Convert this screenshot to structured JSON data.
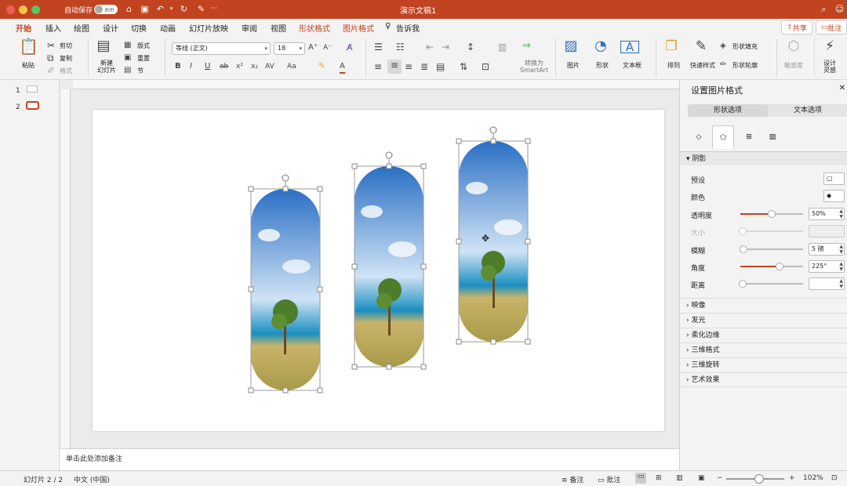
{
  "window": {
    "title": "演示文稿1",
    "autosave_label": "自动保存",
    "autosave_state": "关闭"
  },
  "tabs": [
    {
      "label": "开始",
      "active": true
    },
    {
      "label": "插入"
    },
    {
      "label": "绘图"
    },
    {
      "label": "设计"
    },
    {
      "label": "切换"
    },
    {
      "label": "动画"
    },
    {
      "label": "幻灯片放映"
    },
    {
      "label": "审阅"
    },
    {
      "label": "视图"
    },
    {
      "label": "形状格式",
      "contextual": true
    },
    {
      "label": "图片格式",
      "contextual": true
    },
    {
      "label": "告诉我"
    }
  ],
  "header_buttons": {
    "share": "共享",
    "comment": "批注"
  },
  "ribbon": {
    "paste": "粘贴",
    "cut": "剪切",
    "copy": "复制",
    "format": "格式",
    "new_slide": "新建\n幻灯片",
    "layout": "版式",
    "reset": "重置",
    "section": "节",
    "font_name": "等线 (正文)",
    "font_size": "18",
    "convert_smartart": "转换为\nSmartArt",
    "picture": "图片",
    "shape": "形状",
    "textbox": "文本框",
    "arrange": "排列",
    "quick_styles": "快速样式",
    "shape_fill": "形状填充",
    "shape_outline": "形状轮廓",
    "sensitivity": "敏感度",
    "designer": "设计\n灵感"
  },
  "slides_panel": {
    "items": [
      {
        "number": "1"
      },
      {
        "number": "2",
        "selected": true
      }
    ]
  },
  "notes_placeholder": "单击此处添加备注",
  "status": {
    "slide_counter": "幻灯片 2 / 2",
    "language": "中文 (中国)",
    "notes": "备注",
    "comments": "批注",
    "zoom": "102%",
    "zoom_fraction": 0.55
  },
  "format_pane": {
    "title": "设置图片格式",
    "tab_shape": "形状选项",
    "tab_text": "文本选项",
    "section_shadow": "阴影",
    "rows": {
      "preset": "预设",
      "color": "颜色",
      "transparency": {
        "label": "透明度",
        "value": "50%",
        "fraction": 0.5
      },
      "size": {
        "label": "大小",
        "value": ""
      },
      "blur": {
        "label": "模糊",
        "value": "5 磅",
        "fraction": 0.05
      },
      "angle": {
        "label": "角度",
        "value": "225°",
        "fraction": 0.625
      },
      "distance": {
        "label": "距离",
        "value": ""
      }
    },
    "collapsed": [
      "映像",
      "发光",
      "柔化边缘",
      "三维格式",
      "三维旋转",
      "艺术效果"
    ]
  },
  "colors": {
    "accent": "#c2431f",
    "sky_top": "#2a6fc4",
    "sky_bottom": "#cfe3f5",
    "sea": "#1a8fc0",
    "sand": "#c9b469",
    "tree": "#4e7d2a"
  }
}
